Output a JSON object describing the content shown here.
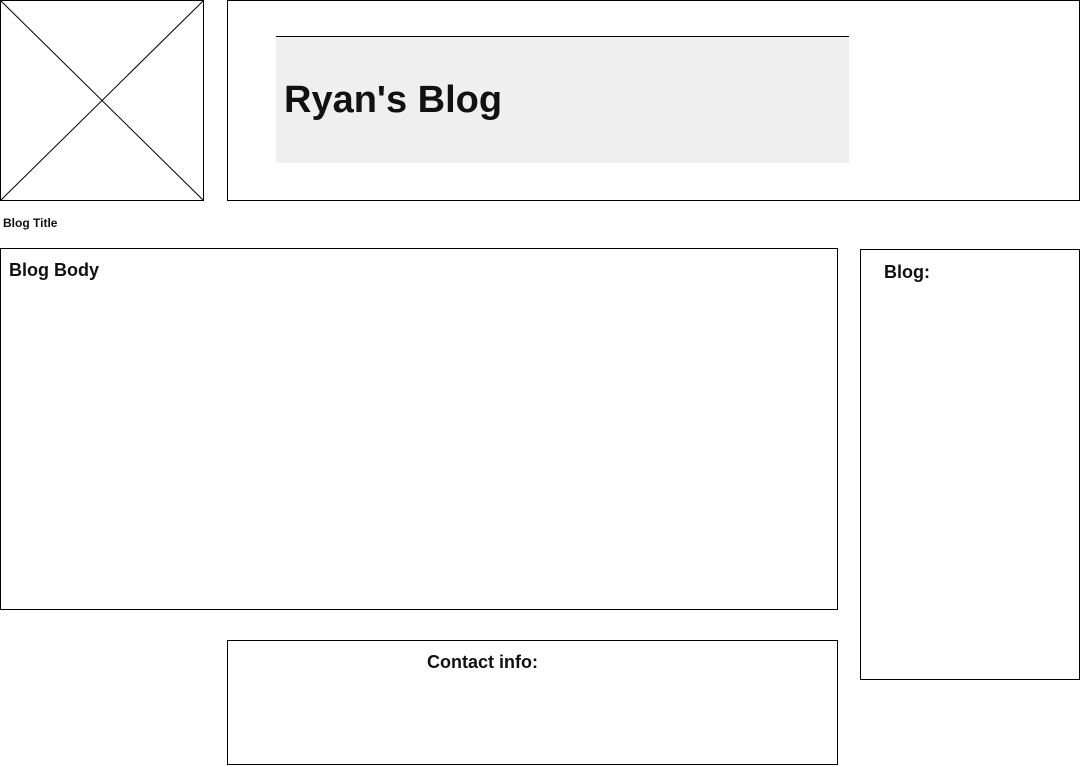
{
  "header": {
    "title": "Ryan's Blog"
  },
  "logo": {
    "icon": "image-placeholder-icon",
    "caption": "Blog Title"
  },
  "main": {
    "body_label": "Blog Body"
  },
  "sidebar": {
    "label": "Blog:"
  },
  "footer": {
    "contact_label": "Contact info:"
  },
  "colors": {
    "border": "#000000",
    "title_bar_bg": "#efefef",
    "background": "#ffffff",
    "text": "#111111"
  }
}
